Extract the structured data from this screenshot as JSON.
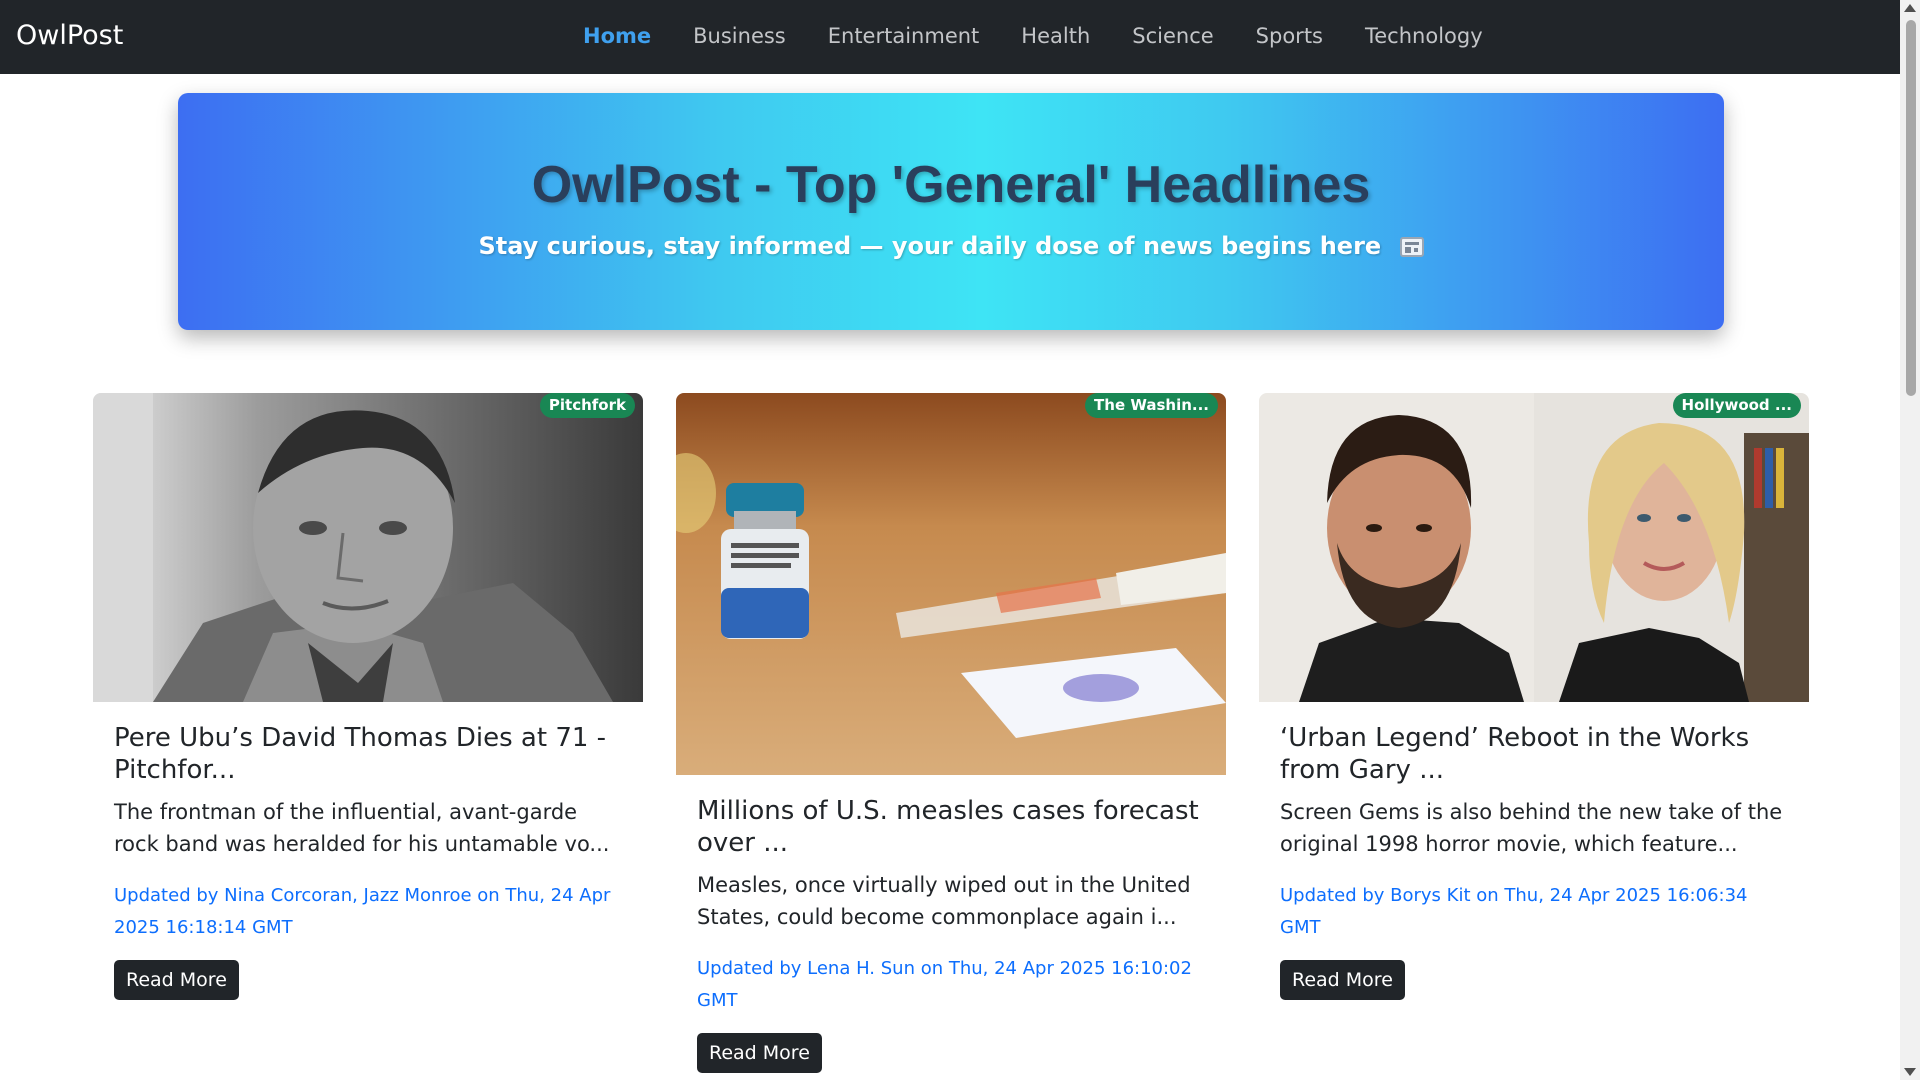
{
  "navbar": {
    "brand": "OwlPost",
    "links": [
      {
        "label": "Home",
        "active": true
      },
      {
        "label": "Business",
        "active": false
      },
      {
        "label": "Entertainment",
        "active": false
      },
      {
        "label": "Health",
        "active": false
      },
      {
        "label": "Science",
        "active": false
      },
      {
        "label": "Sports",
        "active": false
      },
      {
        "label": "Technology",
        "active": false
      }
    ]
  },
  "hero": {
    "title": "OwlPost - Top 'General' Headlines",
    "subtitle": "Stay curious, stay informed — your daily dose of news begins here",
    "icon": "newspaper-icon"
  },
  "articles": [
    {
      "source": "Pitchfork",
      "title": "Pere Ubu’s David Thomas Dies at 71 - Pitchfor...",
      "description": "The frontman of the influential, avant-garde rock band was heralded for his untamable vo...",
      "meta": "Updated by Nina Corcoran, Jazz Monroe on Thu, 24 Apr 2025 16:18:14 GMT",
      "button": "Read More"
    },
    {
      "source": "The Washin...",
      "title": "Millions of U.S. measles cases forecast over ...",
      "description": "Measles, once virtually wiped out in the United States, could become commonplace again i...",
      "meta": "Updated by Lena H. Sun on Thu, 24 Apr 2025 16:10:02 GMT",
      "button": "Read More"
    },
    {
      "source": "Hollywood ...",
      "title": "‘Urban Legend’ Reboot in the Works from Gary ...",
      "description": "Screen Gems is also behind the new take of the original 1998 horror movie, which feature...",
      "meta": "Updated by Borys Kit on Thu, 24 Apr 2025 16:06:34 GMT",
      "button": "Read More"
    }
  ],
  "colors": {
    "navbar_bg": "#212529",
    "nav_active": "#3fa0ee",
    "badge": "#198754",
    "meta_link": "#0d6efd",
    "button_bg": "#212529"
  }
}
